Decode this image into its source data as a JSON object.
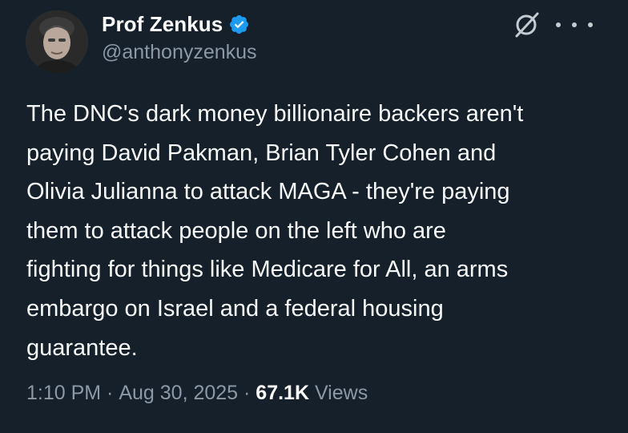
{
  "author": {
    "display_name": "Prof Zenkus",
    "handle": "@anthonyzenkus",
    "verified": true,
    "avatar_icon": "profile-photo"
  },
  "header_icons": {
    "grok_icon": "grok-icon",
    "more_icon": "more-options-icon"
  },
  "tweet": {
    "lines": [
      "The DNC's dark money billionaire backers aren't",
      "paying David Pakman, Brian Tyler Cohen and",
      "Olivia Julianna to attack MAGA - they're paying",
      "them to attack people on the left who are",
      "fighting for things like Medicare for All, an arms",
      "embargo on Israel and a federal housing",
      "guarantee."
    ]
  },
  "meta": {
    "time": "1:10 PM",
    "separator1": " · ",
    "date": "Aug 30, 2025",
    "separator2": " · ",
    "views_count": "67.1K",
    "views_label": " Views"
  },
  "colors": {
    "background": "#15202b",
    "text": "#f7f9f9",
    "secondary": "#8b98a5",
    "verified": "#1d9bf0"
  }
}
